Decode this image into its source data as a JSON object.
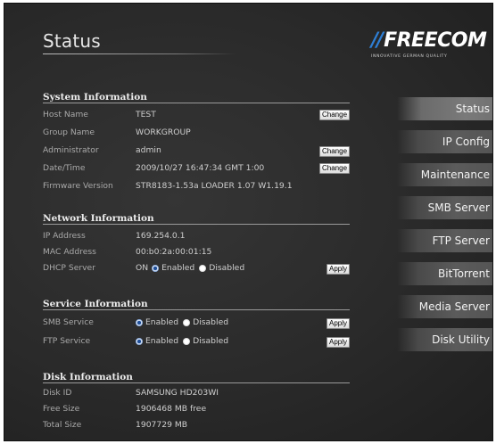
{
  "page": {
    "title": "Status"
  },
  "logo": {
    "bars": "//",
    "name": "FREECOM",
    "tagline": "INNOVATIVE GERMAN QUALITY"
  },
  "system": {
    "header": "System Information",
    "host_name": {
      "label": "Host Name",
      "value": "TEST",
      "button": "Change"
    },
    "group_name": {
      "label": "Group Name",
      "value": "WORKGROUP"
    },
    "administrator": {
      "label": "Administrator",
      "value": "admin",
      "button": "Change"
    },
    "datetime": {
      "label": "Date/Time",
      "value": "2009/10/27 16:47:34 GMT 1:00",
      "button": "Change"
    },
    "firmware": {
      "label": "Firmware Version",
      "value": "STR8183-1.53a LOADER 1.07 W1.19.1"
    }
  },
  "network": {
    "header": "Network Information",
    "ip": {
      "label": "IP Address",
      "value": "169.254.0.1"
    },
    "mac": {
      "label": "MAC Address",
      "value": "00:b0:2a:00:01:15"
    },
    "dhcp": {
      "label": "DHCP Server",
      "prefix": "ON",
      "enabled": "Enabled",
      "disabled": "Disabled",
      "selected": "Enabled",
      "button": "Apply"
    }
  },
  "service": {
    "header": "Service Information",
    "smb": {
      "label": "SMB Service",
      "enabled": "Enabled",
      "disabled": "Disabled",
      "selected": "Enabled",
      "button": "Apply"
    },
    "ftp": {
      "label": "FTP Service",
      "enabled": "Enabled",
      "disabled": "Disabled",
      "selected": "Enabled",
      "button": "Apply"
    }
  },
  "disk": {
    "header": "Disk Information",
    "id": {
      "label": "Disk ID",
      "value": "SAMSUNG HD203WI"
    },
    "free": {
      "label": "Free Size",
      "value": "1906468 MB free"
    },
    "total": {
      "label": "Total Size",
      "value": "1907729 MB"
    }
  },
  "nav": {
    "active": "Status",
    "items": [
      {
        "label": "Status"
      },
      {
        "label": "IP Config"
      },
      {
        "label": "Maintenance"
      },
      {
        "label": "SMB Server"
      },
      {
        "label": "FTP Server"
      },
      {
        "label": "BitTorrent"
      },
      {
        "label": "Media Server"
      },
      {
        "label": "Disk Utility"
      }
    ]
  },
  "colors": {
    "background": "#2b2b2b",
    "logo_accent": "#2e7fd6",
    "text": "#cfcfcf",
    "label": "#a9a9a9"
  }
}
